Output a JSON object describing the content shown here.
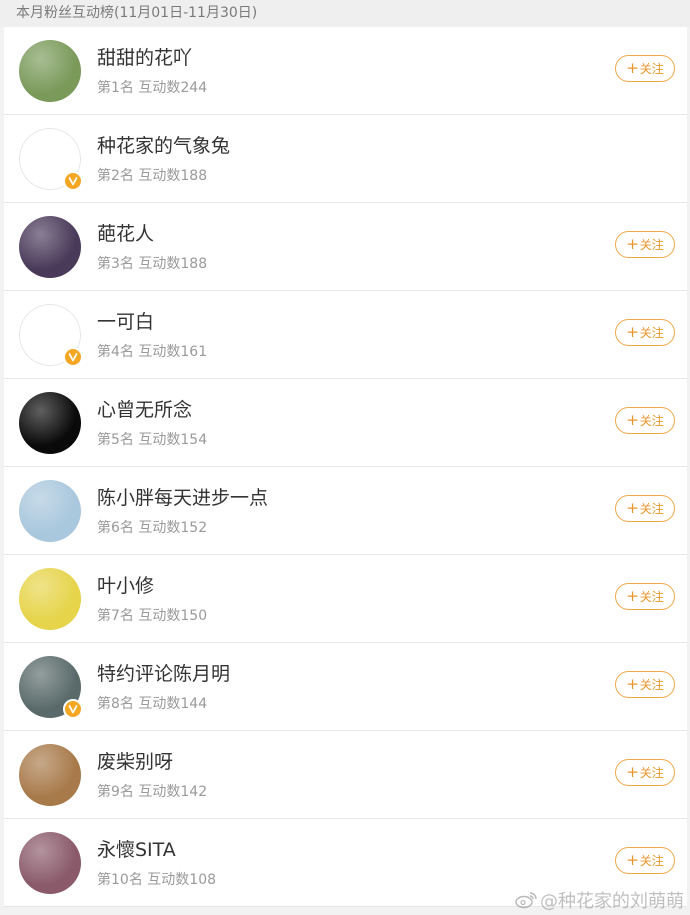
{
  "header": {
    "title": "本月粉丝互动榜(11月01日-11月30日)"
  },
  "follow_label": "关注",
  "follow_plus": "+",
  "rows": [
    {
      "name": "甜甜的花吖",
      "rank": "第1名",
      "count": "互动数244",
      "verified": false,
      "follow": true,
      "avatar_color": "#7a9a5a"
    },
    {
      "name": "种花家的气象兔",
      "rank": "第2名",
      "count": "互动数188",
      "verified": true,
      "follow": false,
      "avatar_color": "#ffffff"
    },
    {
      "name": "葩花人",
      "rank": "第3名",
      "count": "互动数188",
      "verified": false,
      "follow": true,
      "avatar_color": "#4a3a5a"
    },
    {
      "name": "一可白",
      "rank": "第4名",
      "count": "互动数161",
      "verified": true,
      "follow": true,
      "avatar_color": "#ffffff"
    },
    {
      "name": "心曾无所念",
      "rank": "第5名",
      "count": "互动数154",
      "verified": false,
      "follow": true,
      "avatar_color": "#0a0a0a"
    },
    {
      "name": "陈小胖每天进步一点",
      "rank": "第6名",
      "count": "互动数152",
      "verified": false,
      "follow": true,
      "avatar_color": "#a9c7dd"
    },
    {
      "name": "叶小修",
      "rank": "第7名",
      "count": "互动数150",
      "verified": false,
      "follow": true,
      "avatar_color": "#e6d44a"
    },
    {
      "name": "特约评论陈月明",
      "rank": "第8名",
      "count": "互动数144",
      "verified": true,
      "follow": true,
      "avatar_color": "#5a6a6a"
    },
    {
      "name": "废柴别呀",
      "rank": "第9名",
      "count": "互动数142",
      "verified": false,
      "follow": true,
      "avatar_color": "#a87a4a"
    },
    {
      "name": "永懷SITA",
      "rank": "第10名",
      "count": "互动数108",
      "verified": false,
      "follow": true,
      "avatar_color": "#8a5a6a"
    }
  ],
  "watermark": {
    "text": "@种花家的刘萌萌"
  },
  "colors": {
    "accent": "#f0a848",
    "badge": "#f5a623"
  }
}
